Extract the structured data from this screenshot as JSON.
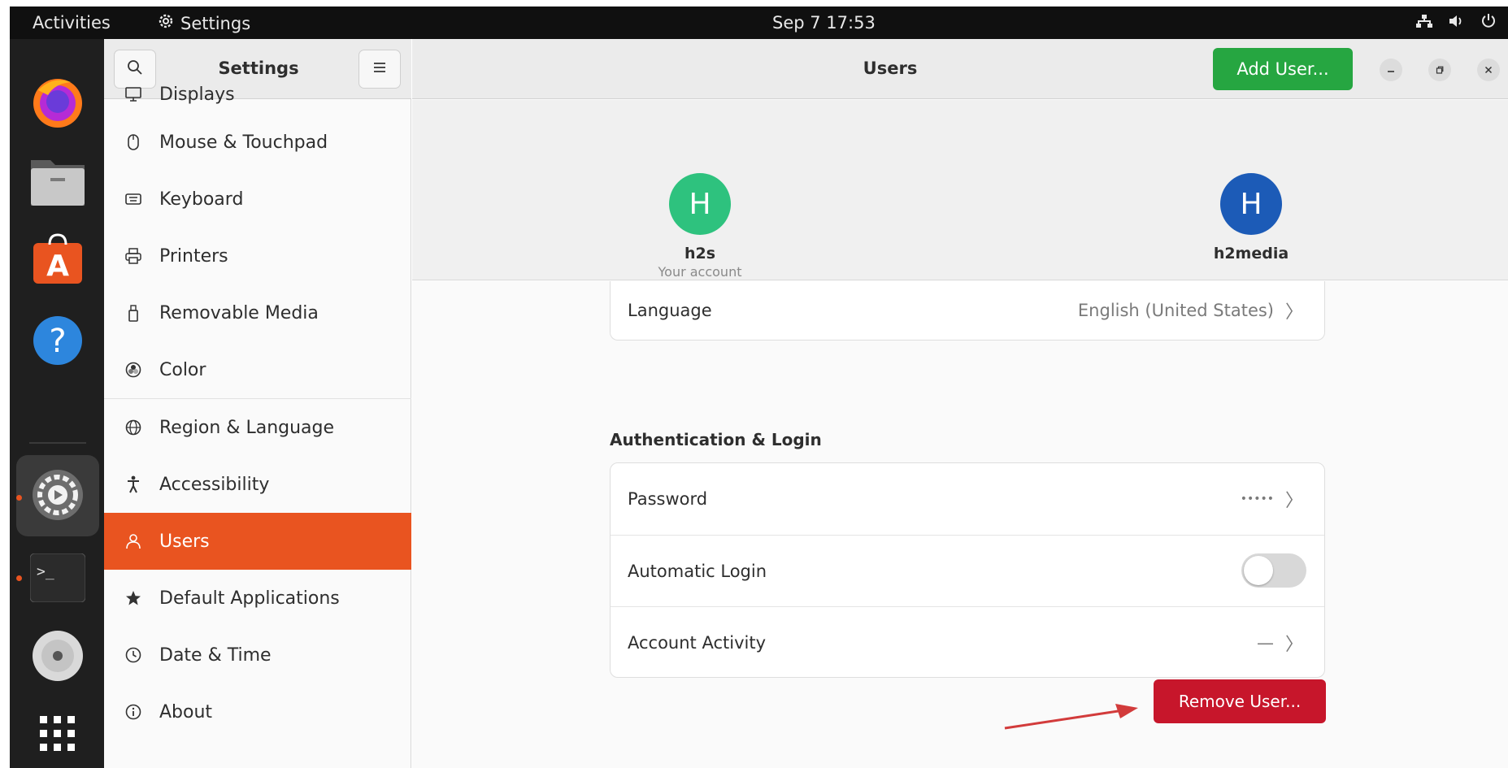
{
  "topbar": {
    "activities": "Activities",
    "app_menu": "Settings",
    "clock": "Sep 7  17:53",
    "icons": [
      "network-icon",
      "volume-icon",
      "power-icon"
    ]
  },
  "dock": {
    "apps": [
      "firefox-icon",
      "files-icon",
      "app-center-icon",
      "help-icon",
      "settings-icon",
      "terminal-icon",
      "disc-icon",
      "app-grid-icon"
    ]
  },
  "sidebar": {
    "title": "Settings",
    "items": [
      {
        "label": "Displays",
        "icon": "display-icon"
      },
      {
        "label": "Mouse & Touchpad",
        "icon": "mouse-icon"
      },
      {
        "label": "Keyboard",
        "icon": "keyboard-icon"
      },
      {
        "label": "Printers",
        "icon": "printer-icon"
      },
      {
        "label": "Removable Media",
        "icon": "usb-icon"
      },
      {
        "label": "Color",
        "icon": "color-icon"
      },
      {
        "label": "Region & Language",
        "icon": "globe-icon"
      },
      {
        "label": "Accessibility",
        "icon": "accessibility-icon"
      },
      {
        "label": "Users",
        "icon": "user-icon",
        "active": true
      },
      {
        "label": "Default Applications",
        "icon": "star-icon"
      },
      {
        "label": "Date & Time",
        "icon": "clock-icon"
      },
      {
        "label": "About",
        "icon": "info-icon"
      }
    ]
  },
  "main": {
    "title": "Users",
    "add_user_label": "Add User...",
    "users": [
      {
        "initial": "H",
        "name": "h2s",
        "subtitle": "Your account",
        "color": "#2ec27e"
      },
      {
        "initial": "H",
        "name": "h2media",
        "subtitle": "",
        "color": "#1c5bb7"
      }
    ],
    "language_row": {
      "label": "Language",
      "value": "English (United States)"
    },
    "auth_section_title": "Authentication & Login",
    "auth_rows": {
      "password": {
        "label": "Password",
        "value": "•••••"
      },
      "automatic_login": {
        "label": "Automatic Login",
        "enabled": false
      },
      "account_activity": {
        "label": "Account Activity",
        "value": "—"
      }
    },
    "remove_user_label": "Remove User..."
  },
  "colors": {
    "accent": "#e95420",
    "add_button": "#26a641",
    "remove_button": "#c7162b",
    "annotation_arrow": "#d23b3b"
  }
}
